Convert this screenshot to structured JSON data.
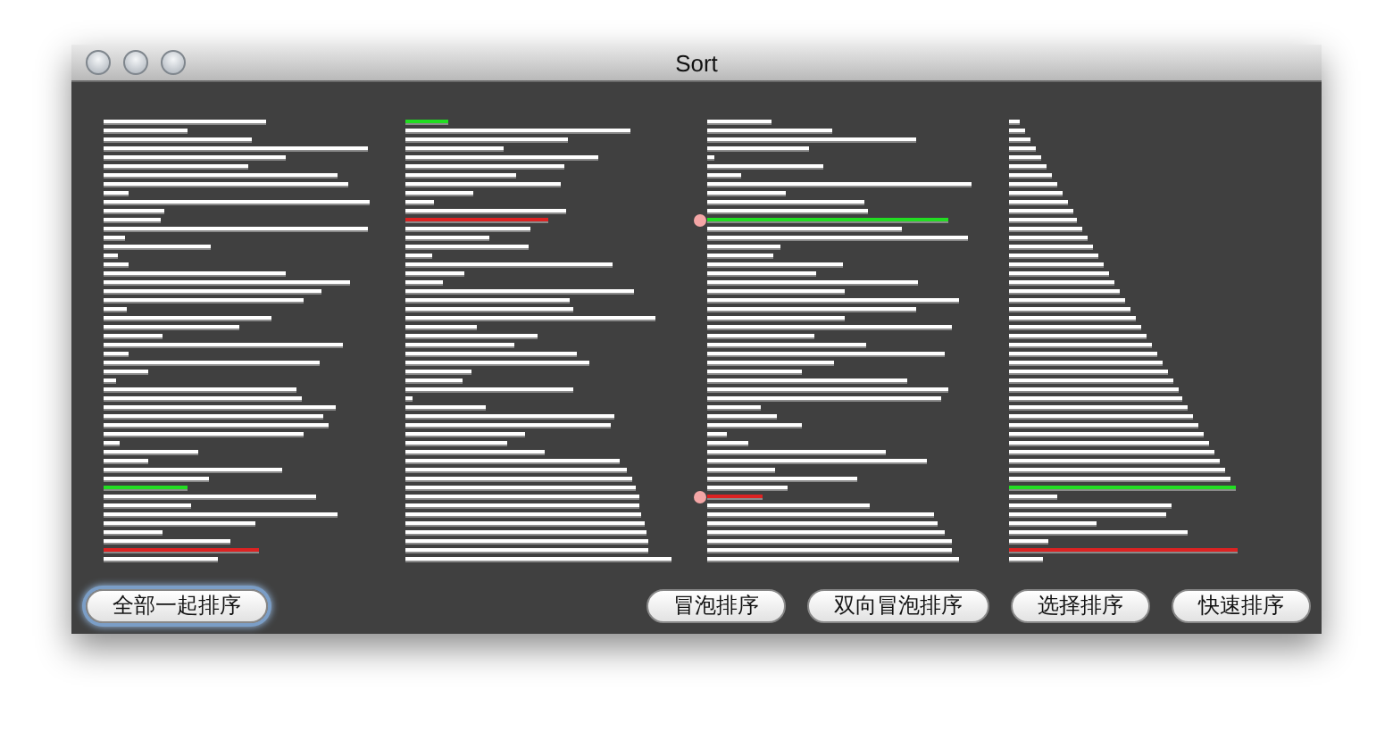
{
  "window": {
    "title": "Sort"
  },
  "buttons": [
    {
      "label": "全部一起排序",
      "focused": true
    },
    {
      "label": "冒泡排序",
      "focused": false
    },
    {
      "label": "双向冒泡排序",
      "focused": false
    },
    {
      "label": "选择排序",
      "focused": false
    },
    {
      "label": "快速排序",
      "focused": false
    }
  ]
}
